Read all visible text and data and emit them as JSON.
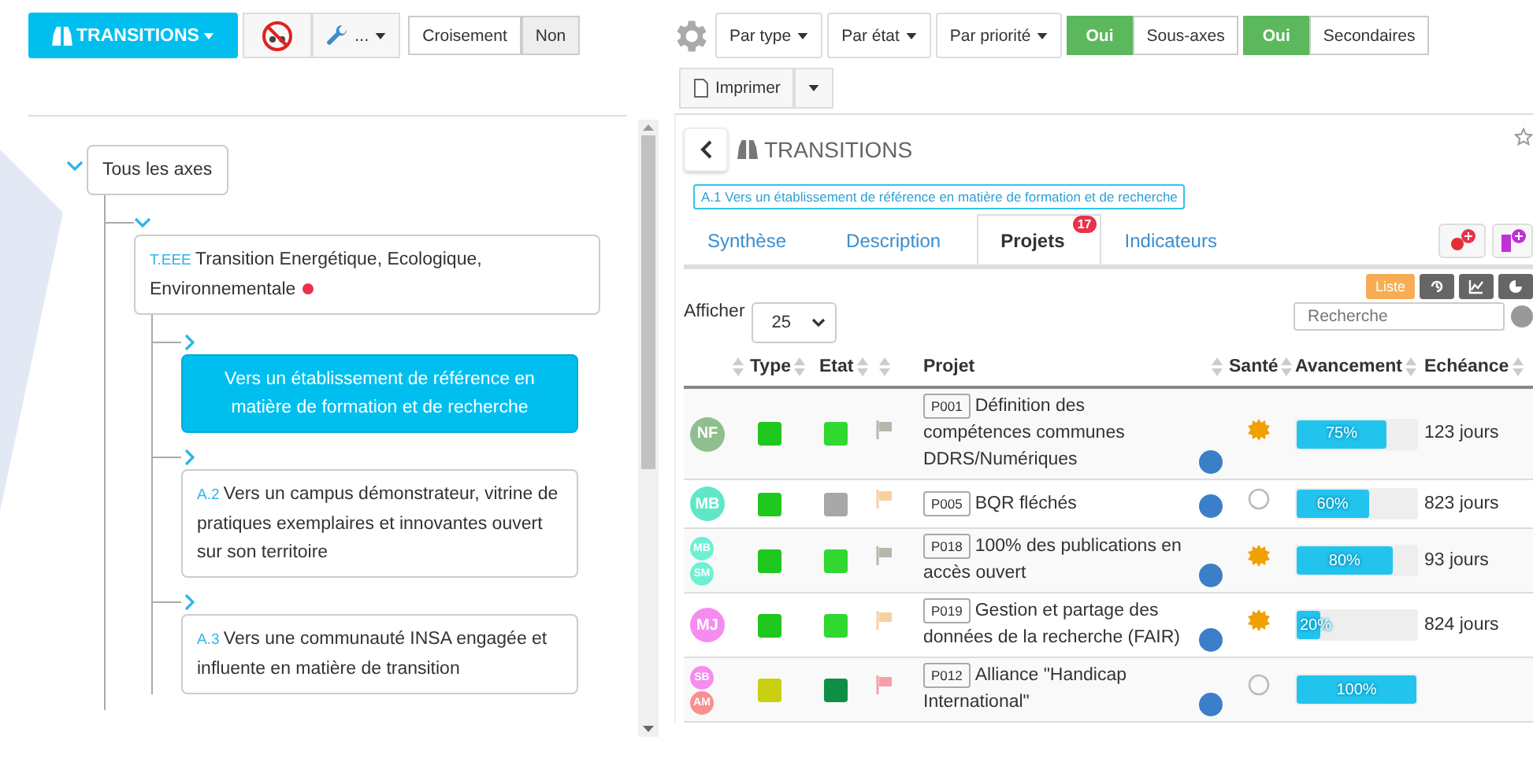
{
  "left_toolbar": {
    "menu_button": "TRANSITIONS",
    "tools_button": "...",
    "crossing": {
      "label": "Croisement",
      "value": "Non"
    }
  },
  "tree": {
    "label": "Tous les axes",
    "expanded": true,
    "children": [
      {
        "code": "T.EEE",
        "label": "Transition Energétique, Ecologique, Environnementale",
        "alert": true,
        "expanded": true,
        "selected": false,
        "children": [
          {
            "label": "Vers un établissement de référence en matière de formation et de recherche",
            "selected": true,
            "expanded": false
          },
          {
            "code": "A.2",
            "label": "Vers un campus démonstrateur, vitrine de pratiques exemplaires et innovantes ouvert sur son territoire",
            "selected": false,
            "expanded": false
          },
          {
            "code": "A.3",
            "label": "Vers une communauté INSA engagée et influente en matière de transition",
            "selected": false,
            "expanded": false
          }
        ]
      }
    ]
  },
  "filters": [
    "Par type",
    "Par état",
    "Par priorité"
  ],
  "toggles": [
    {
      "value": "Oui",
      "label": "Sous-axes",
      "on": true
    },
    {
      "value": "Oui",
      "label": "Secondaires",
      "on": true
    }
  ],
  "print_button": "Imprimer",
  "panel": {
    "title": "TRANSITIONS",
    "axis_badge": "A.1 Vers un établissement de référence en matière de formation et de recherche",
    "tabs": [
      {
        "label": "Synthèse",
        "selected": false
      },
      {
        "label": "Description",
        "selected": false
      },
      {
        "label": "Projets",
        "selected": true,
        "badge": "17"
      },
      {
        "label": "Indicateurs",
        "selected": false
      }
    ],
    "views": [
      {
        "kind": "list",
        "label": "Liste",
        "selected": true
      },
      {
        "kind": "history",
        "selected": false
      },
      {
        "kind": "chart",
        "selected": false
      },
      {
        "kind": "pie",
        "selected": false
      }
    ],
    "show_label": "Afficher",
    "page_size": "25",
    "search": {
      "placeholder": "Recherche"
    },
    "table": {
      "columns": [
        "",
        "Type",
        "Etat",
        "",
        "Projet",
        "Santé",
        "Avancement",
        "Echéance"
      ],
      "rows": [
        {
          "avatars": [
            {
              "initials": "NF",
              "color": "#8fbf8f"
            }
          ],
          "type": {
            "color": "#1ec81e"
          },
          "state": {
            "color": "#30d830"
          },
          "flag": {
            "color": "#b4b8aa"
          },
          "code": "P001",
          "title": "Définition des compétences communes DDRS/Numériques",
          "health": {
            "kind": "sun"
          },
          "level": 0.75,
          "progress": "75%",
          "due": "123 jours"
        },
        {
          "avatars": [
            {
              "initials": "MB",
              "color": "#5ee8c8"
            }
          ],
          "type": {
            "color": "#1ec81e"
          },
          "state": {
            "color": "#a8a8a8"
          },
          "flag": {
            "color": "#f8d0a0"
          },
          "code": "P005",
          "title": "BQR fléchés",
          "health": {
            "kind": "none"
          },
          "level": 0.6,
          "progress": "60%",
          "due": "823 jours"
        },
        {
          "avatars": [
            {
              "initials": "MB",
              "color": "#6ef0d2"
            },
            {
              "initials": "SM",
              "color": "#6ef0d2"
            }
          ],
          "type": {
            "color": "#1ec81e"
          },
          "state": {
            "color": "#30d830"
          },
          "flag": {
            "color": "#b4b8aa"
          },
          "code": "P018",
          "title": "100% des publications en accès ouvert",
          "health": {
            "kind": "sun"
          },
          "level": 0.8,
          "progress": "80%",
          "due": "93 jours"
        },
        {
          "avatars": [
            {
              "initials": "MJ",
              "color": "#f58cf0"
            }
          ],
          "type": {
            "color": "#1ec81e"
          },
          "state": {
            "color": "#30d830"
          },
          "flag": {
            "color": "#f8d0a0"
          },
          "code": "P019",
          "title": "Gestion et partage des données de la recherche (FAIR)",
          "health": {
            "kind": "sun"
          },
          "level": 0.2,
          "progress": "20%",
          "due": "824 jours"
        },
        {
          "avatars": [
            {
              "initials": "SB",
              "color": "#f58cf0"
            },
            {
              "initials": "AM",
              "color": "#f99090"
            }
          ],
          "type": {
            "color": "#c8d010"
          },
          "state": {
            "color": "#0f8f45"
          },
          "flag": {
            "color": "#f4a0a8"
          },
          "code": "P012",
          "title": "Alliance \"Handicap International\"",
          "health": {
            "kind": "none"
          },
          "level": 1,
          "progress": "100%"
        }
      ]
    }
  }
}
